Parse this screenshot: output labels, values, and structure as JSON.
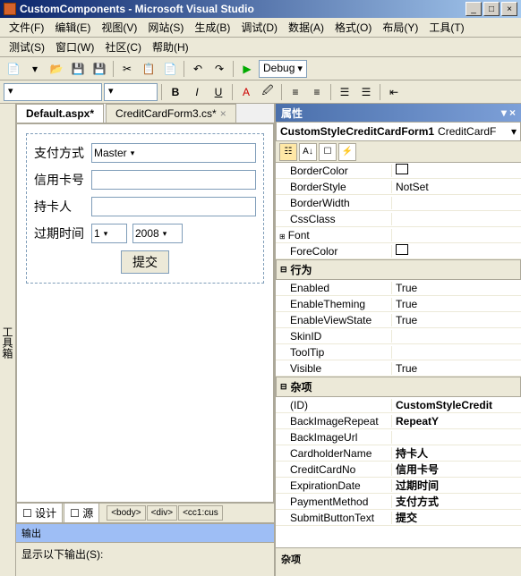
{
  "title": "CustomComponents - Microsoft Visual Studio",
  "menu": {
    "file": "文件(F)",
    "edit": "编辑(E)",
    "view": "视图(V)",
    "website": "网站(S)",
    "build": "生成(B)",
    "debug": "调试(D)",
    "data": "数据(A)",
    "format": "格式(O)",
    "layout": "布局(Y)",
    "tools": "工具(T)",
    "test": "测试(S)",
    "window": "窗口(W)",
    "community": "社区(C)",
    "help": "帮助(H)"
  },
  "config_dropdown": "Debug",
  "sidetab": "工具箱",
  "doc_tabs": {
    "active": "Default.aspx*",
    "second": "CreditCardForm3.cs*"
  },
  "form": {
    "payment_label": "支付方式",
    "payment_value": "Master",
    "cardno_label": "信用卡号",
    "cardno_value": "",
    "holder_label": "持卡人",
    "holder_value": "",
    "expire_label": "过期时间",
    "expire_month": "1",
    "expire_year": "2008",
    "submit": "提交"
  },
  "bottom_tabs": {
    "design": "设计",
    "source": "源"
  },
  "breadcrumb": [
    "<body>",
    "<div>",
    "<cc1:cus"
  ],
  "output": {
    "header": "输出",
    "label": "显示以下输出(S):"
  },
  "props": {
    "panel_title": "属性",
    "object_bold": "CustomStyleCreditCardForm1",
    "object_type": "CreditCardF",
    "cat_behavior": "行为",
    "cat_misc": "杂项",
    "rows": {
      "BorderColor": "",
      "BorderStyle": "NotSet",
      "BorderWidth": "",
      "CssClass": "",
      "Font": "",
      "ForeColor": "",
      "Enabled": "True",
      "EnableTheming": "True",
      "EnableViewState": "True",
      "SkinID": "",
      "ToolTip": "",
      "Visible": "True",
      "ID": "CustomStyleCredit",
      "BackImageRepeat": "RepeatY",
      "BackImageUrl": "",
      "CardholderName": "持卡人",
      "CreditCardNo": "信用卡号",
      "ExpirationDate": "过期时间",
      "PaymentMethod": "支付方式",
      "SubmitButtonText": "提交"
    },
    "desc": "杂项"
  }
}
